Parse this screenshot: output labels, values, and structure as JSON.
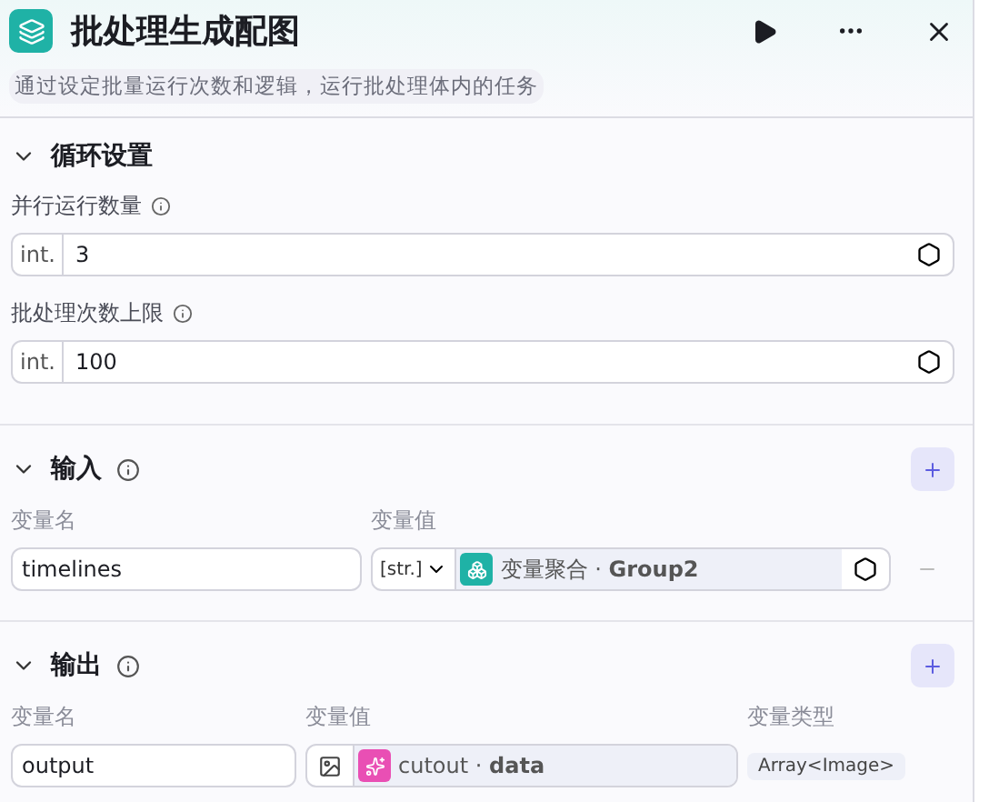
{
  "header": {
    "title": "批处理生成配图",
    "description": "通过设定批量运行次数和逻辑，运行批处理体内的任务"
  },
  "settings": {
    "title": "循环设置",
    "expanded": true,
    "fields": [
      {
        "label": "并行运行数量",
        "type": "int.",
        "value": "3"
      },
      {
        "label": "批处理次数上限",
        "type": "int.",
        "value": "100"
      }
    ]
  },
  "input": {
    "title": "输入",
    "expanded": true,
    "columns": [
      "变量名",
      "变量值"
    ],
    "rows": [
      {
        "name": "timelines",
        "type": "[str.]",
        "reference": "变量聚合 · **Group2**"
      }
    ]
  },
  "output": {
    "title": "输出",
    "expanded": true,
    "columns": [
      "变量名",
      "变量值",
      "变量类型"
    ],
    "rows": [
      {
        "name": "output",
        "reference": "cutout · **data**",
        "var_type": "Array<Image>"
      }
    ]
  }
}
